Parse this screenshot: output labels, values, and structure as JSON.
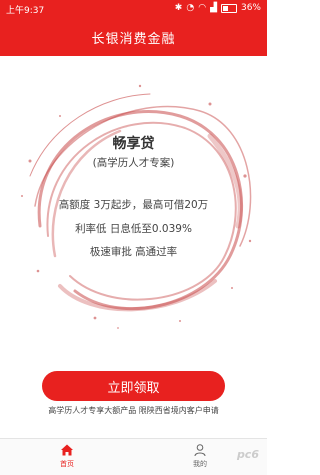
{
  "status_bar": {
    "time": "上午9:37",
    "battery": "36%"
  },
  "header": {
    "title": "长银消费金融"
  },
  "product": {
    "name": "畅享贷",
    "subtitle": "(高学历人才专案)",
    "features": [
      "高额度  3万起步，最高可借20万",
      "利率低  日息低至0.039%",
      "极速审批  高通过率"
    ]
  },
  "apply_button": {
    "label": "立即领取"
  },
  "note": {
    "text": "高学历人才专享大额产品    限陕西省境内客户申请"
  },
  "tab_bar": {
    "items": [
      {
        "label": "首页",
        "icon": "home-icon",
        "active": true
      },
      {
        "label": "我的",
        "icon": "user-icon",
        "active": false
      }
    ]
  },
  "watermark": {
    "text": "pc6"
  },
  "colors": {
    "brand_red": "#e8211f",
    "splash_red": "#c84a4a"
  }
}
